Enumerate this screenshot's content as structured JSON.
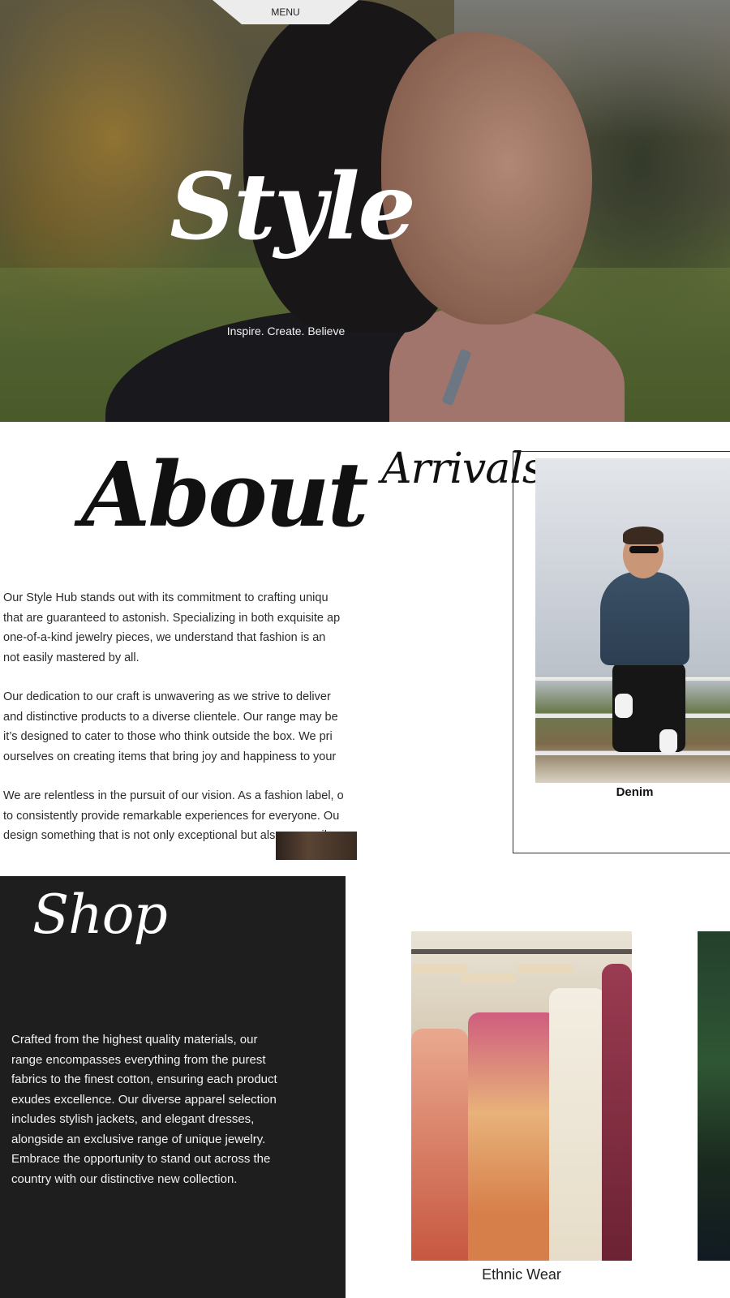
{
  "nav": {
    "menu_label": "MENU"
  },
  "hero": {
    "title": "Style",
    "tagline": "Inspire. Create. Believe"
  },
  "about": {
    "title": "About",
    "paragraphs": [
      [
        "Our Style Hub stands out with its commitment to crafting uniqu",
        "that are guaranteed to astonish. Specializing in both exquisite ap",
        "one-of-a-kind jewelry pieces, we understand that fashion is an",
        "not easily mastered by all."
      ],
      [
        "Our dedication to our craft is unwavering as we strive to deliver",
        "and distinctive products to a diverse clientele. Our range may be",
        "it’s designed to cater to those who think outside the box. We pri",
        "ourselves on creating items that bring joy and happiness to your"
      ],
      [
        "We are relentless in the pursuit of our vision. As a fashion label, o",
        "to consistently provide remarkable experiences for everyone. Ou",
        "design something that is not only exceptional but also accessib"
      ]
    ]
  },
  "arrivals": {
    "title": "Arrivals",
    "items": [
      {
        "caption": "Denim"
      }
    ]
  },
  "shop": {
    "title": "Shop",
    "body_lines": [
      "Crafted from the highest quality materials, our",
      "range encompasses everything from the purest",
      "fabrics to the finest cotton, ensuring each product",
      "exudes excellence. Our diverse apparel selection",
      "includes stylish jackets, and elegant dresses,",
      "alongside an exclusive range of unique jewelry.",
      "Embrace the opportunity to stand out across the",
      "country with our distinctive new collection."
    ],
    "items": [
      {
        "caption": "Ethnic Wear"
      }
    ]
  }
}
